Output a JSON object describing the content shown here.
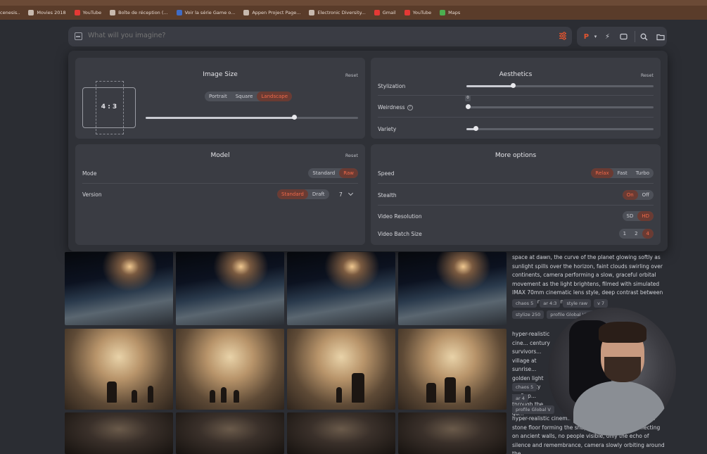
{
  "bookmarks": [
    {
      "label": "cenesis..",
      "color": "#c7b9ae"
    },
    {
      "label": "Movies 2018",
      "color": "#c7b9ae"
    },
    {
      "label": "YouTube",
      "color": "#e53935"
    },
    {
      "label": "Boîte de réception (...",
      "color": "#c7b9ae"
    },
    {
      "label": "Voir la série Game o...",
      "color": "#3f6cc6"
    },
    {
      "label": "Appen Project Page...",
      "color": "#c7b9ae"
    },
    {
      "label": "Electronic Diversity...",
      "color": "#c7b9ae"
    },
    {
      "label": "Gmail",
      "color": "#e53935"
    },
    {
      "label": "YouTube",
      "color": "#e53935"
    },
    {
      "label": "Maps",
      "color": "#4caf50"
    }
  ],
  "search": {
    "placeholder": "What will you imagine?"
  },
  "toolbar": {
    "profile_letter": "P"
  },
  "image_size": {
    "title": "Image Size",
    "reset": "Reset",
    "aspect_label": "4 : 3",
    "options": [
      "Portrait",
      "Square",
      "Landscape"
    ],
    "selected": "Landscape",
    "slider_value": 0.7
  },
  "aesthetics": {
    "title": "Aesthetics",
    "reset": "Reset",
    "stylization_label": "Stylization",
    "stylization_value": 0.25,
    "weirdness_label": "Weirdness",
    "weirdness_value": 0.01,
    "weirdness_tooltip": "0",
    "variety_label": "Variety",
    "variety_value": 0.05
  },
  "model": {
    "title": "Model",
    "reset": "Reset",
    "mode_label": "Mode",
    "mode_options": [
      "Standard",
      "Raw"
    ],
    "mode_selected": "Raw",
    "version_label": "Version",
    "version_options": [
      "Standard",
      "Draft"
    ],
    "version_selected": "Standard",
    "version_number": "7"
  },
  "more_options": {
    "title": "More options",
    "speed_label": "Speed",
    "speed_options": [
      "Relax",
      "Fast",
      "Turbo"
    ],
    "speed_selected": "Relax",
    "stealth_label": "Stealth",
    "stealth_options": [
      "On",
      "Off"
    ],
    "stealth_selected": "On",
    "video_res_label": "Video Resolution",
    "video_res_options": [
      "SD",
      "HD"
    ],
    "video_res_selected": "HD",
    "batch_label": "Video Batch Size",
    "batch_options": [
      "1",
      "2",
      "4"
    ],
    "batch_selected": "4"
  },
  "results": [
    {
      "desc": "space at dawn, the curve of the planet glowing softly as sunlight spills over the horizon, faint clouds swirling over continents, camera performing a slow, graceful orbital movement as the light brightens, filmed with simulated IMAX 70mm cinematic lens style, deep contrast between shadow and golden...",
      "tags": [
        "chaos 5",
        "ar 4:3",
        "style raw",
        "v 7",
        "stylize 250",
        "profile Global V7 Profile"
      ]
    },
    {
      "desc": "hyper-realistic cine... century survivors... village at sunrise... golden light pi... empty rooftop... through the qu...",
      "tags": [
        "chaos 5",
        "ar 4",
        "profile Global V"
      ]
    },
    {
      "desc": "hyper-realistic cinem... medieval church, hundre... the stone floor forming the shape o... golden light reflecting on ancient walls, no people visible, only the echo of silence and remembrance, camera slowly orbiting around the",
      "tags": []
    }
  ]
}
